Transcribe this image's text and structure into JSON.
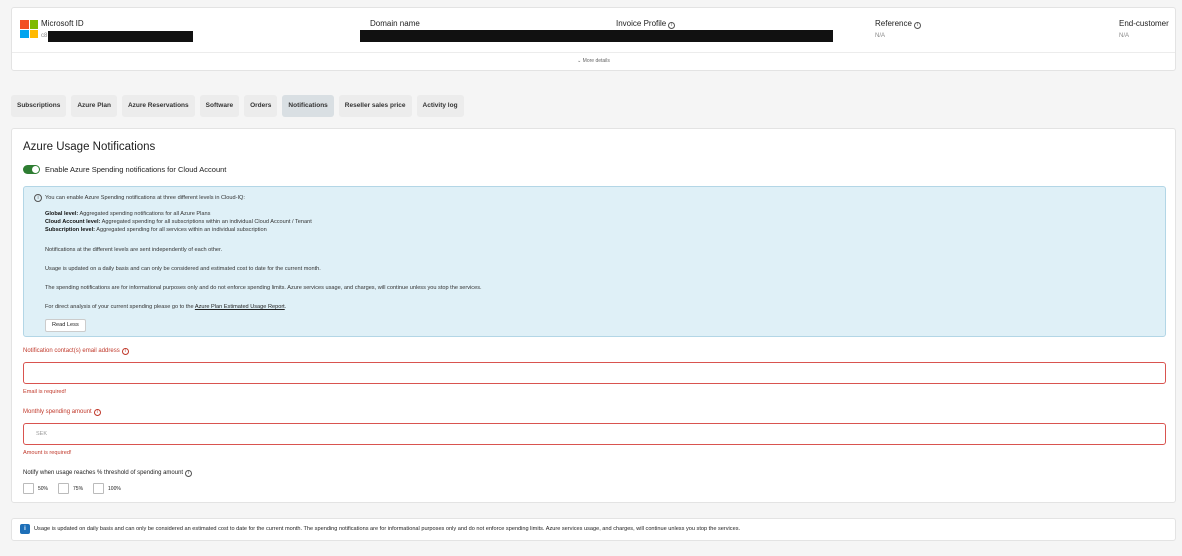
{
  "header": {
    "microsoft_id_label": "Microsoft ID",
    "microsoft_id_value": "c8",
    "domain_name_label": "Domain name",
    "invoice_profile_label": "Invoice Profile",
    "reference_label": "Reference",
    "reference_value": "N/A",
    "end_customer_label": "End-customer",
    "end_customer_value": "N/A",
    "more_details": "More details",
    "info_glyph": "i"
  },
  "tabs": [
    "Subscriptions",
    "Azure Plan",
    "Azure Reservations",
    "Software",
    "Orders",
    "Notifications",
    "Reseller sales price",
    "Activity log"
  ],
  "active_tab": "Notifications",
  "main": {
    "title": "Azure Usage Notifications",
    "toggle_label": "Enable Azure Spending notifications for Cloud Account",
    "toggle_on": true,
    "info": {
      "intro": "You can enable Azure Spending notifications at three different levels in Cloud-IQ:",
      "global_bold": "Global level:",
      "global_text": " Aggregated spending notifications for all Azure Plans",
      "cloud_bold": "Cloud Account level:",
      "cloud_text": " Aggregated spending for all subscriptions within an individual Cloud Account / Tenant",
      "subscription_bold": "Subscription level:",
      "subscription_text": " Aggregated spending for all services within an individual subscription",
      "independent": "Notifications at the different levels are sent independently of each other.",
      "daily": "Usage is updated on a daily basis and can only be considered and estimated cost to date for the current month.",
      "informational": "The spending notifications are for informational purposes only and do not enforce spending limits. Azure services usage, and charges, will continue unless you stop the services.",
      "direct_prefix": "For direct analysis of your current spending please go to the ",
      "direct_link": "Azure Plan Estimated Usage Report",
      "direct_suffix": ".",
      "read_less": "Read Less"
    },
    "email_label": "Notification contact(s) email address",
    "email_value": "",
    "email_error": "Email is required!",
    "amount_label": "Monthly spending amount",
    "amount_placeholder": "SEK",
    "amount_error": "Amount is required!",
    "threshold_label": "Notify when usage reaches % threshold of spending amount",
    "thresholds": [
      "50%",
      "75%",
      "100%"
    ]
  },
  "footer": {
    "text": "Usage is updated on daily basis and can only be considered an estimated cost to date for the current month. The spending notifications are for informational purposes only and do not enforce spending limits. Azure services usage, and charges, will continue unless you stop the services."
  },
  "colors": {
    "toggle_on": "#2e7d32",
    "error": "#c0392b",
    "info_bg": "#dff0f7",
    "footer_icon": "#1e6fb8"
  }
}
